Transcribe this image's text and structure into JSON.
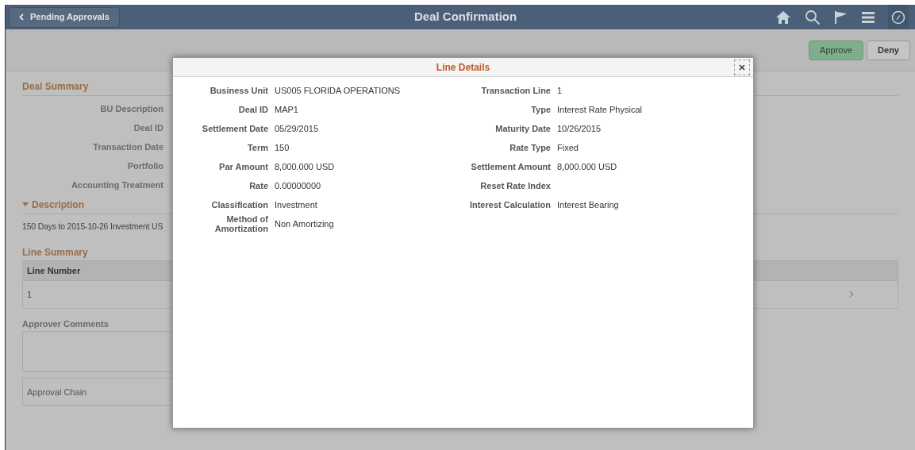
{
  "header": {
    "back_label": "Pending Approvals",
    "title": "Deal Confirmation"
  },
  "actions": [
    {
      "label": "Approve",
      "kind": "primary"
    },
    {
      "label": "Deny",
      "kind": "secondary"
    }
  ],
  "deal_summary": {
    "title": "Deal Summary",
    "fields": [
      "BU Description",
      "Deal ID",
      "Transaction Date",
      "Portfolio",
      "Accounting Treatment"
    ]
  },
  "description": {
    "title": "Description",
    "expanded": true,
    "text": "150 Days to 2015-10-26 Investment US"
  },
  "line_summary": {
    "title": "Line Summary",
    "columns": [
      "Line Number"
    ],
    "rows": [
      {
        "cells": [
          "1"
        ]
      }
    ]
  },
  "approver_comments": {
    "label": "Approver Comments"
  },
  "approval_chain": {
    "label": "Approval Chain"
  },
  "modal": {
    "title": "Line Details",
    "left": [
      {
        "label": "Business Unit",
        "value": "US005 FLORIDA OPERATIONS"
      },
      {
        "label": "Deal ID",
        "value": "MAP1"
      },
      {
        "label": "Settlement Date",
        "value": "05/29/2015"
      },
      {
        "label": "Term",
        "value": "150"
      },
      {
        "label": "Par Amount",
        "value": "8,000.000 USD"
      },
      {
        "label": "Rate",
        "value": "0.00000000"
      },
      {
        "label": "Classification",
        "value": "Investment"
      },
      {
        "label": "Method of Amortization",
        "value": "Non Amortizing"
      }
    ],
    "right": [
      {
        "label": "Transaction Line",
        "value": "1"
      },
      {
        "label": "Type",
        "value": "Interest Rate Physical"
      },
      {
        "label": "Maturity Date",
        "value": "10/26/2015"
      },
      {
        "label": "Rate Type",
        "value": "Fixed"
      },
      {
        "label": "Settlement Amount",
        "value": "8,000.000 USD"
      },
      {
        "label": "Reset Rate Index"
      },
      {
        "label": "Interest Calculation",
        "value": "Interest Bearing"
      }
    ]
  }
}
